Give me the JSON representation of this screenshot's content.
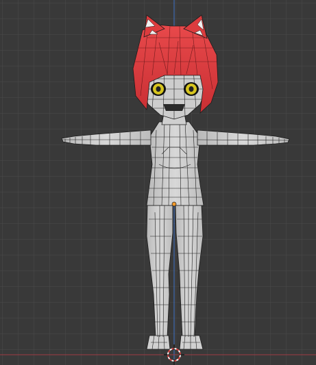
{
  "viewport": {
    "view": "front-orthographic",
    "shading": "solid-wireframe-overlay",
    "background_color": "#393939",
    "grid_color": "#4a4a4a",
    "z_axis_color": "#3f72c9",
    "x_axis_color": "#a03a44",
    "wire_color": "#1c1c1c"
  },
  "model": {
    "body_color": "#cfcfcf",
    "hair_color": "#dc3c3e",
    "eye_color": "#d6c41f",
    "cat_ear_tips": "white",
    "pose": "T-pose"
  },
  "cursor": {
    "icon": "3d-cursor-icon",
    "colors": [
      "#d94040",
      "#ffffff"
    ]
  },
  "origin": {
    "icon": "object-origin-icon",
    "color": "#f39a2a"
  }
}
